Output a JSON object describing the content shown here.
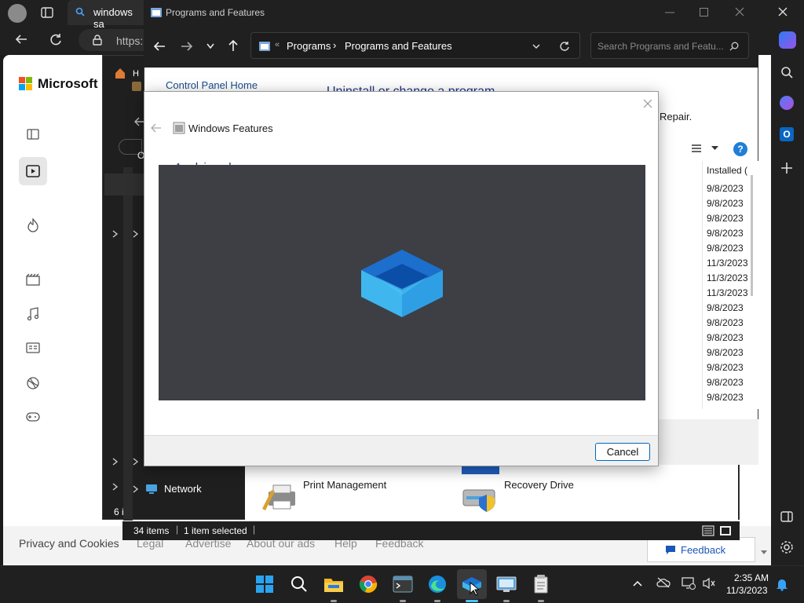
{
  "edge": {
    "tab_title": "windows sa",
    "address": "https:",
    "bing_logo": "Microsoft Bin",
    "footer_links": [
      "Privacy and Cookies",
      "Legal",
      "Advertise",
      "About our ads",
      "Help",
      "Feedback"
    ],
    "feedback_button": "Feedback"
  },
  "explorer": {
    "status_items": "34 items",
    "status_selected": "1 item selected",
    "network_label": "Network",
    "count_fragment": "6 i",
    "tab_fragment": "H",
    "side_fragment": "O",
    "items": [
      {
        "label": "Print Management",
        "icon": "print-management-icon"
      },
      {
        "label": "Recovery Drive",
        "icon": "recovery-drive-icon"
      }
    ]
  },
  "programs": {
    "window_title": "Programs and Features",
    "breadcrumb": [
      "Programs",
      "Programs and Features"
    ],
    "search_placeholder": "Search Programs and Featu...",
    "control_panel_home": "Control Panel Home",
    "heading_partial": "Uninstall or change a program",
    "repair_text": "Repair.",
    "column_installed": "Installed (",
    "dates": [
      "9/8/2023",
      "9/8/2023",
      "9/8/2023",
      "9/8/2023",
      "9/8/2023",
      "11/3/2023",
      "11/3/2023",
      "11/3/2023",
      "9/8/2023",
      "9/8/2023",
      "9/8/2023",
      "9/8/2023",
      "9/8/2023",
      "9/8/2023",
      "9/8/2023"
    ]
  },
  "features_dialog": {
    "title": "Windows Features",
    "status_partial": "Applying changes",
    "cancel_label": "Cancel"
  },
  "taskbar": {
    "time": "2:35 AM",
    "date": "11/3/2023",
    "apps": [
      "start-icon",
      "search-icon",
      "file-explorer-icon",
      "chrome-icon",
      "terminal-icon",
      "edge-icon",
      "windows-features-icon",
      "remote-desktop-icon",
      "notepad-icon"
    ]
  },
  "colors": {
    "accent": "#0067c0",
    "dialog_progress_bg": "#3d3f44",
    "chrome_dark": "#202020"
  }
}
